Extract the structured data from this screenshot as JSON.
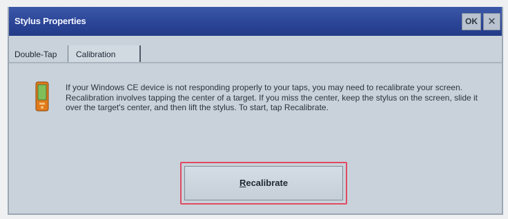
{
  "window": {
    "title": "Stylus Properties",
    "ok_label": "OK",
    "close_glyph": "✕"
  },
  "tabs": [
    {
      "label": "Double-Tap",
      "selected": false
    },
    {
      "label": "Calibration",
      "selected": true
    }
  ],
  "content": {
    "icon": "pocket-device-icon",
    "paragraph1": "If your Windows CE device is not responding properly to your taps, you may need to recalibrate your screen.",
    "paragraph2": "Recalibration involves tapping the center of a target. If you miss the center, keep the stylus on the screen, slide it over the target's center, and then lift the stylus. To start, tap Recalibrate."
  },
  "recalibrate": {
    "accel_letter": "R",
    "label_rest": "ecalibrate",
    "highlight_color": "#e04a63"
  },
  "colors": {
    "titlebar": "#2c4597",
    "dialog_bg": "#c9d2da"
  }
}
